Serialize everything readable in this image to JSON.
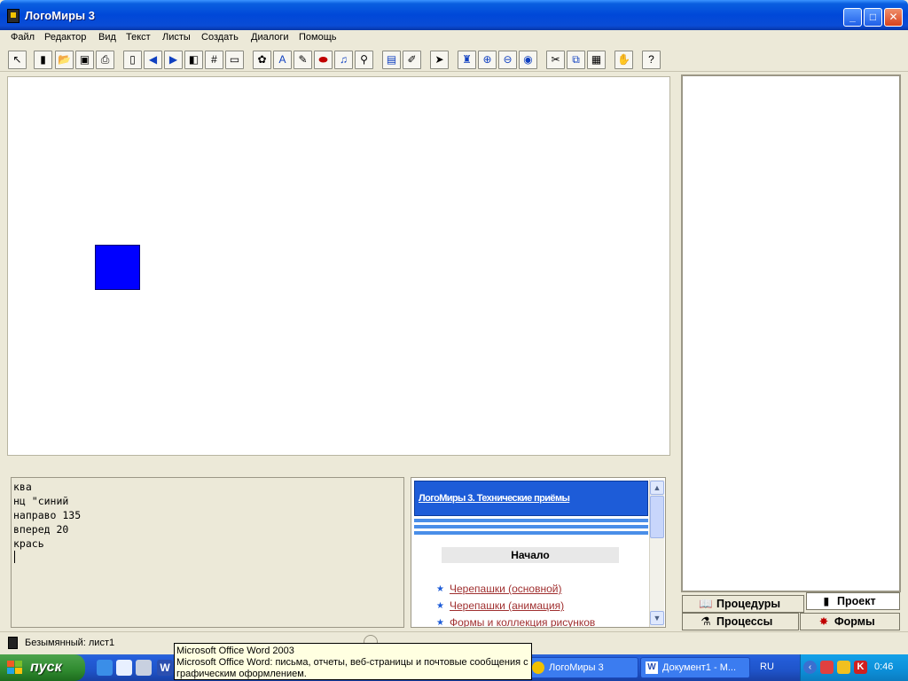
{
  "window": {
    "title": "ЛогоМиры 3"
  },
  "menu": [
    "Файл",
    "Редактор",
    "Вид",
    "Текст",
    "Листы",
    "Создать",
    "Диалоги",
    "Помощь"
  ],
  "command_center": {
    "lines": [
      "ква",
      "нц \"синий",
      "направо 135",
      "вперед 20",
      "крась"
    ]
  },
  "help": {
    "header": "ЛогоМиры 3. Технические приёмы",
    "start": "Начало",
    "links": [
      "Черепашки (основной)",
      "Черепашки (анимация)",
      "Формы и коллекция рисунков"
    ]
  },
  "tabs": {
    "procedures": "Процедуры",
    "project": "Проект",
    "processes": "Процессы",
    "forms": "Формы"
  },
  "status": {
    "text": "Безымянный: лист1"
  },
  "taskbar": {
    "start": "пуск",
    "tasks": [
      "ЛогоМиры 3",
      "Документ1 - M..."
    ],
    "lang": "RU",
    "clock": "0:46"
  },
  "tooltip": {
    "line1": "Microsoft Office Word 2003",
    "line2": "Microsoft Office Word: письма, отчеты, веб-страницы и почтовые сообщения с",
    "line3": "графическим оформлением."
  },
  "colors": {
    "turtle_fill": "#0000ff",
    "title_bar": "#0048d8",
    "tray": "#0c8fd8"
  }
}
